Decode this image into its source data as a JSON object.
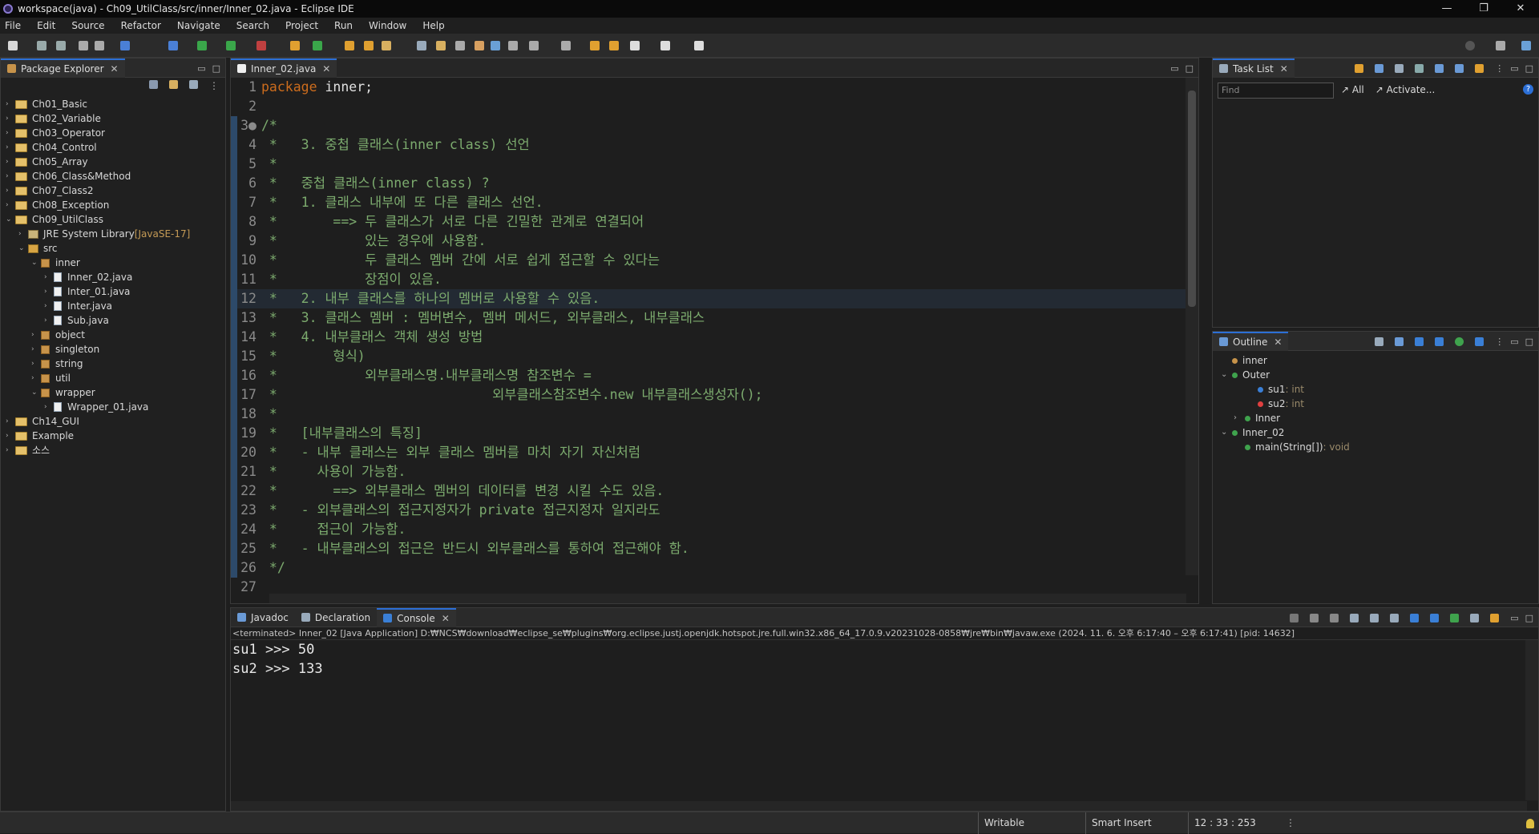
{
  "window": {
    "title": "workspace(java) - Ch09_UtilClass/src/inner/Inner_02.java - Eclipse IDE",
    "controls": [
      "—",
      "❐",
      "✕"
    ]
  },
  "menu": [
    "File",
    "Edit",
    "Source",
    "Refactor",
    "Navigate",
    "Search",
    "Project",
    "Run",
    "Window",
    "Help"
  ],
  "package_explorer": {
    "tab_label": "Package Explorer",
    "tree": [
      {
        "label": "Ch01_Basic",
        "kind": "project",
        "depth": 0,
        "twisty": "›"
      },
      {
        "label": "Ch02_Variable",
        "kind": "project",
        "depth": 0,
        "twisty": "›"
      },
      {
        "label": "Ch03_Operator",
        "kind": "project",
        "depth": 0,
        "twisty": "›"
      },
      {
        "label": "Ch04_Control",
        "kind": "project",
        "depth": 0,
        "twisty": "›"
      },
      {
        "label": "Ch05_Array",
        "kind": "project",
        "depth": 0,
        "twisty": "›"
      },
      {
        "label": "Ch06_Class&Method",
        "kind": "project",
        "depth": 0,
        "twisty": "›"
      },
      {
        "label": "Ch07_Class2",
        "kind": "project",
        "depth": 0,
        "twisty": "›"
      },
      {
        "label": "Ch08_Exception",
        "kind": "project",
        "depth": 0,
        "twisty": "›"
      },
      {
        "label": "Ch09_UtilClass",
        "kind": "project",
        "depth": 0,
        "twisty": "⌄"
      },
      {
        "label": "JRE System Library",
        "deco": "[JavaSE-17]",
        "kind": "lib",
        "depth": 1,
        "twisty": "›"
      },
      {
        "label": "src",
        "kind": "src",
        "depth": 1,
        "twisty": "⌄"
      },
      {
        "label": "inner",
        "kind": "pkg",
        "depth": 2,
        "twisty": "⌄"
      },
      {
        "label": "Inner_02.java",
        "kind": "java",
        "depth": 3,
        "twisty": "›"
      },
      {
        "label": "Inter_01.java",
        "kind": "java",
        "depth": 3,
        "twisty": "›"
      },
      {
        "label": "Inter.java",
        "kind": "java",
        "depth": 3,
        "twisty": "›"
      },
      {
        "label": "Sub.java",
        "kind": "java",
        "depth": 3,
        "twisty": "›"
      },
      {
        "label": "object",
        "kind": "pkg",
        "depth": 2,
        "twisty": "›"
      },
      {
        "label": "singleton",
        "kind": "pkg",
        "depth": 2,
        "twisty": "›"
      },
      {
        "label": "string",
        "kind": "pkg",
        "depth": 2,
        "twisty": "›"
      },
      {
        "label": "util",
        "kind": "pkg",
        "depth": 2,
        "twisty": "›"
      },
      {
        "label": "wrapper",
        "kind": "pkg",
        "depth": 2,
        "twisty": "⌄"
      },
      {
        "label": "Wrapper_01.java",
        "kind": "java",
        "depth": 3,
        "twisty": "›"
      },
      {
        "label": "Ch14_GUI",
        "kind": "project",
        "depth": 0,
        "twisty": "›"
      },
      {
        "label": "Example",
        "kind": "project",
        "depth": 0,
        "twisty": "›"
      },
      {
        "label": "소스",
        "kind": "project",
        "depth": 0,
        "twisty": "›"
      }
    ]
  },
  "editor": {
    "tab_label": "Inner_02.java",
    "lines": [
      {
        "n": "1",
        "kw": "package",
        "text": " inner;"
      },
      {
        "n": "2",
        "text": ""
      },
      {
        "n": "3●",
        "text": "/*",
        "comment": true
      },
      {
        "n": "4",
        "text": " *   3. 중첩 클래스(inner class) 선언",
        "comment": true
      },
      {
        "n": "5",
        "text": " *",
        "comment": true
      },
      {
        "n": "6",
        "text": " *   중첩 클래스(inner class) ?",
        "comment": true
      },
      {
        "n": "7",
        "text": " *   1. 클래스 내부에 또 다른 클래스 선언.",
        "comment": true
      },
      {
        "n": "8",
        "text": " *       ==> 두 클래스가 서로 다른 긴밀한 관계로 연결되어",
        "comment": true
      },
      {
        "n": "9",
        "text": " *           있는 경우에 사용함.",
        "comment": true
      },
      {
        "n": "10",
        "text": " *           두 클래스 멤버 간에 서로 쉽게 접근할 수 있다는",
        "comment": true
      },
      {
        "n": "11",
        "text": " *           장점이 있음.",
        "comment": true
      },
      {
        "n": "12",
        "text": " *   2. 내부 클래스를 하나의 멤버로 사용할 수 있음.",
        "comment": true
      },
      {
        "n": "13",
        "text": " *   3. 클래스 멤버 : 멤버변수, 멤버 메서드, 외부클래스, 내부클래스",
        "comment": true
      },
      {
        "n": "14",
        "text": " *   4. 내부클래스 객체 생성 방법",
        "comment": true
      },
      {
        "n": "15",
        "text": " *       형식)",
        "comment": true
      },
      {
        "n": "16",
        "text": " *           외부클래스명.내부클래스명 참조변수 =",
        "comment": true
      },
      {
        "n": "17",
        "text": " *                           외부클래스참조변수.new 내부클래스생성자();",
        "comment": true
      },
      {
        "n": "18",
        "text": " *",
        "comment": true
      },
      {
        "n": "19",
        "text": " *   [내부클래스의 특징]",
        "comment": true
      },
      {
        "n": "20",
        "text": " *   - 내부 클래스는 외부 클래스 멤버를 마치 자기 자신처럼",
        "comment": true
      },
      {
        "n": "21",
        "text": " *     사용이 가능함.",
        "comment": true
      },
      {
        "n": "22",
        "text": " *       ==> 외부클래스 멤버의 데이터를 변경 시킬 수도 있음.",
        "comment": true
      },
      {
        "n": "23",
        "text": " *   - 외부클래스의 접근지정자가 private 접근지정자 일지라도",
        "comment": true
      },
      {
        "n": "24",
        "text": " *     접근이 가능함.",
        "comment": true
      },
      {
        "n": "25",
        "text": " *   - 내부클래스의 접근은 반드시 외부클래스를 통하여 접근해야 함.",
        "comment": true
      },
      {
        "n": "26",
        "text": " */",
        "comment": true
      },
      {
        "n": "27",
        "text": ""
      }
    ]
  },
  "task_list": {
    "tab_label": "Task List",
    "find_placeholder": "Find",
    "all_label": "All",
    "activate_label": "Activate..."
  },
  "outline": {
    "tab_label": "Outline",
    "items": [
      {
        "label": "inner",
        "type": "",
        "depth": 0,
        "twisty": "",
        "color": "#c7934a"
      },
      {
        "label": "Outer",
        "type": "",
        "depth": 0,
        "twisty": "⌄",
        "color": "#3fa34d"
      },
      {
        "label": "su1",
        "type": " : int",
        "depth": 2,
        "twisty": "",
        "color": "#3a7fd6"
      },
      {
        "label": "su2",
        "type": " : int",
        "depth": 2,
        "twisty": "",
        "color": "#e04040"
      },
      {
        "label": "Inner",
        "type": "",
        "depth": 1,
        "twisty": "›",
        "color": "#3fa34d"
      },
      {
        "label": "Inner_02",
        "type": "",
        "depth": 0,
        "twisty": "⌄",
        "color": "#3fa34d"
      },
      {
        "label": "main(String[])",
        "type": " : void",
        "depth": 1,
        "twisty": "",
        "color": "#3fa34d"
      }
    ]
  },
  "bottom": {
    "tabs": [
      "Javadoc",
      "Declaration",
      "Console"
    ],
    "status": "<terminated> Inner_02 [Java Application] D:₩NCS₩download₩eclipse_se₩plugins₩org.eclipse.justj.openjdk.hotspot.jre.full.win32.x86_64_17.0.9.v20231028-0858₩jre₩bin₩javaw.exe  (2024. 11. 6. 오후 6:17:40 – 오후 6:17:41) [pid: 14632]",
    "output": [
      "su1 >>> 50",
      "su2 >>> 133"
    ]
  },
  "statusbar": {
    "writable": "Writable",
    "insert_mode": "Smart Insert",
    "position": "12 : 33 : 253"
  }
}
